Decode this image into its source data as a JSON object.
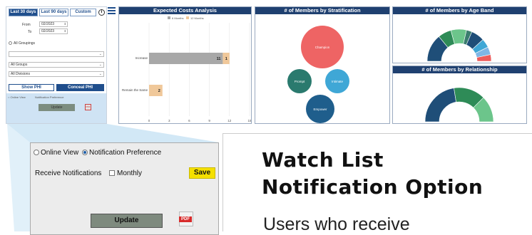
{
  "filters": {
    "tabs": [
      "Last 30 days",
      "Last 90 days",
      "Custom"
    ],
    "info_icon": "info-icon",
    "menu_icon": "hamburger-icon",
    "from_label": "From",
    "from_value": "02/2023",
    "to_label": "To",
    "to_value": "02/2023",
    "all_groupings_label": "All Groupings",
    "grouping_select": "",
    "groups_select": "All Groups",
    "divisions_select": "All Divisions",
    "show_phi": "Show PHI",
    "conceal_phi": "Conceal PHI",
    "mini_online_view": "Online View",
    "mini_notification_pref": "Notification Preference",
    "mini_update": "Update",
    "mini_pdf": "PDF"
  },
  "costs_tile": {
    "title": "Expected Costs Analysis",
    "legend": [
      "6 Months",
      "12 Months"
    ],
    "chart_data": {
      "type": "bar",
      "categories": [
        "Increase",
        "Remain the Same"
      ],
      "series": [
        {
          "name": "6 Months",
          "values": [
            11,
            2
          ]
        },
        {
          "name": "12 Months",
          "values": [
            1,
            0
          ]
        }
      ],
      "xticks": [
        "0",
        "3",
        "6",
        "9",
        "12",
        "15"
      ],
      "xlim": [
        0,
        15
      ],
      "colors": [
        "#a8a8a8",
        "#f0c89a"
      ]
    }
  },
  "strat_tile": {
    "title": "# of Members by Stratification",
    "bubbles": [
      "Champion",
      "Prompt",
      "Intimate",
      "Empower"
    ],
    "colors": [
      "#ee6464",
      "#2a7a6e",
      "#3fa7d6",
      "#1f5e8c"
    ]
  },
  "age_tile": {
    "title": "# of Members by Age Band",
    "chart_data": {
      "type": "pie",
      "values": [
        25,
        12,
        14,
        5,
        12,
        8,
        7,
        6
      ],
      "colors": [
        "#1f4e78",
        "#2e8b57",
        "#6cc58b",
        "#3a7d6e",
        "#1f4e78",
        "#3fa7d6",
        "#7fb6e6",
        "#ee5b5b"
      ]
    }
  },
  "rel_tile": {
    "title": "# of Members by Relationship",
    "chart_data": {
      "type": "pie",
      "values": [
        45,
        30,
        25
      ],
      "colors": [
        "#1f4e78",
        "#2e8b57",
        "#6cc58b"
      ]
    }
  },
  "callout": {
    "online_view": "Online View",
    "notification_pref": "Notification Preference",
    "receive_label": "Receive Notifications",
    "monthly_label": "Monthly",
    "save_label": "Save",
    "update_label": "Update",
    "pdf_label": "PDF"
  },
  "article": {
    "heading_line1": "Watch List",
    "heading_line2": "Notification Option",
    "body_start": "Users who receive"
  }
}
